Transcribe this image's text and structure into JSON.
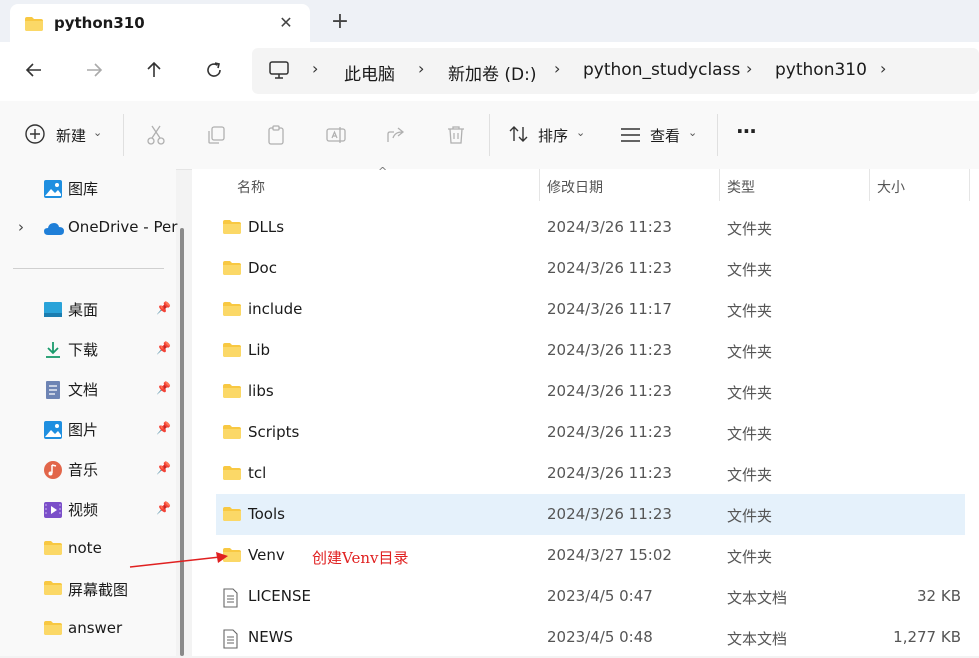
{
  "window": {
    "tab_title": "python310",
    "close_glyph": "✕",
    "new_tab_glyph": "+"
  },
  "nav": {
    "breadcrumbs": [
      "此电脑",
      "新加卷 (D:)",
      "python_studyclass",
      "python310"
    ]
  },
  "toolbar": {
    "new_label": "新建",
    "sort_label": "排序",
    "view_label": "查看",
    "more_label": "···"
  },
  "sidebar": {
    "top_items": [
      {
        "label": "图库",
        "icon": "gallery-icon"
      },
      {
        "label": "OneDrive - Per",
        "icon": "onedrive-icon"
      }
    ],
    "pinned_items": [
      {
        "label": "桌面",
        "icon": "desktop-icon"
      },
      {
        "label": "下载",
        "icon": "download-icon"
      },
      {
        "label": "文档",
        "icon": "document-icon"
      },
      {
        "label": "图片",
        "icon": "pictures-icon"
      },
      {
        "label": "音乐",
        "icon": "music-icon"
      },
      {
        "label": "视频",
        "icon": "video-icon"
      }
    ],
    "folder_items": [
      {
        "label": "note",
        "icon": "folder-icon"
      },
      {
        "label": "屏幕截图",
        "icon": "folder-icon"
      },
      {
        "label": "answer",
        "icon": "folder-icon"
      }
    ]
  },
  "columns": {
    "name": "名称",
    "date": "修改日期",
    "type": "类型",
    "size": "大小"
  },
  "files": [
    {
      "name": "DLLs",
      "date": "2024/3/26 11:23",
      "type": "文件夹",
      "size": "",
      "kind": "folder"
    },
    {
      "name": "Doc",
      "date": "2024/3/26 11:23",
      "type": "文件夹",
      "size": "",
      "kind": "folder"
    },
    {
      "name": "include",
      "date": "2024/3/26 11:17",
      "type": "文件夹",
      "size": "",
      "kind": "folder"
    },
    {
      "name": "Lib",
      "date": "2024/3/26 11:23",
      "type": "文件夹",
      "size": "",
      "kind": "folder"
    },
    {
      "name": "libs",
      "date": "2024/3/26 11:23",
      "type": "文件夹",
      "size": "",
      "kind": "folder"
    },
    {
      "name": "Scripts",
      "date": "2024/3/26 11:23",
      "type": "文件夹",
      "size": "",
      "kind": "folder"
    },
    {
      "name": "tcl",
      "date": "2024/3/26 11:23",
      "type": "文件夹",
      "size": "",
      "kind": "folder"
    },
    {
      "name": "Tools",
      "date": "2024/3/26 11:23",
      "type": "文件夹",
      "size": "",
      "kind": "folder",
      "selected": true
    },
    {
      "name": "Venv",
      "date": "2024/3/27 15:02",
      "type": "文件夹",
      "size": "",
      "kind": "folder"
    },
    {
      "name": "LICENSE",
      "date": "2023/4/5 0:47",
      "type": "文本文档",
      "size": "32 KB",
      "kind": "text"
    },
    {
      "name": "NEWS",
      "date": "2023/4/5 0:48",
      "type": "文本文档",
      "size": "1,277 KB",
      "kind": "text"
    }
  ],
  "annotation": {
    "text": "创建Venv目录",
    "color": "#e02020"
  },
  "colors": {
    "accent": "#0067c0",
    "folder": "#f8c842",
    "selected_row": "#e5f1fb"
  }
}
